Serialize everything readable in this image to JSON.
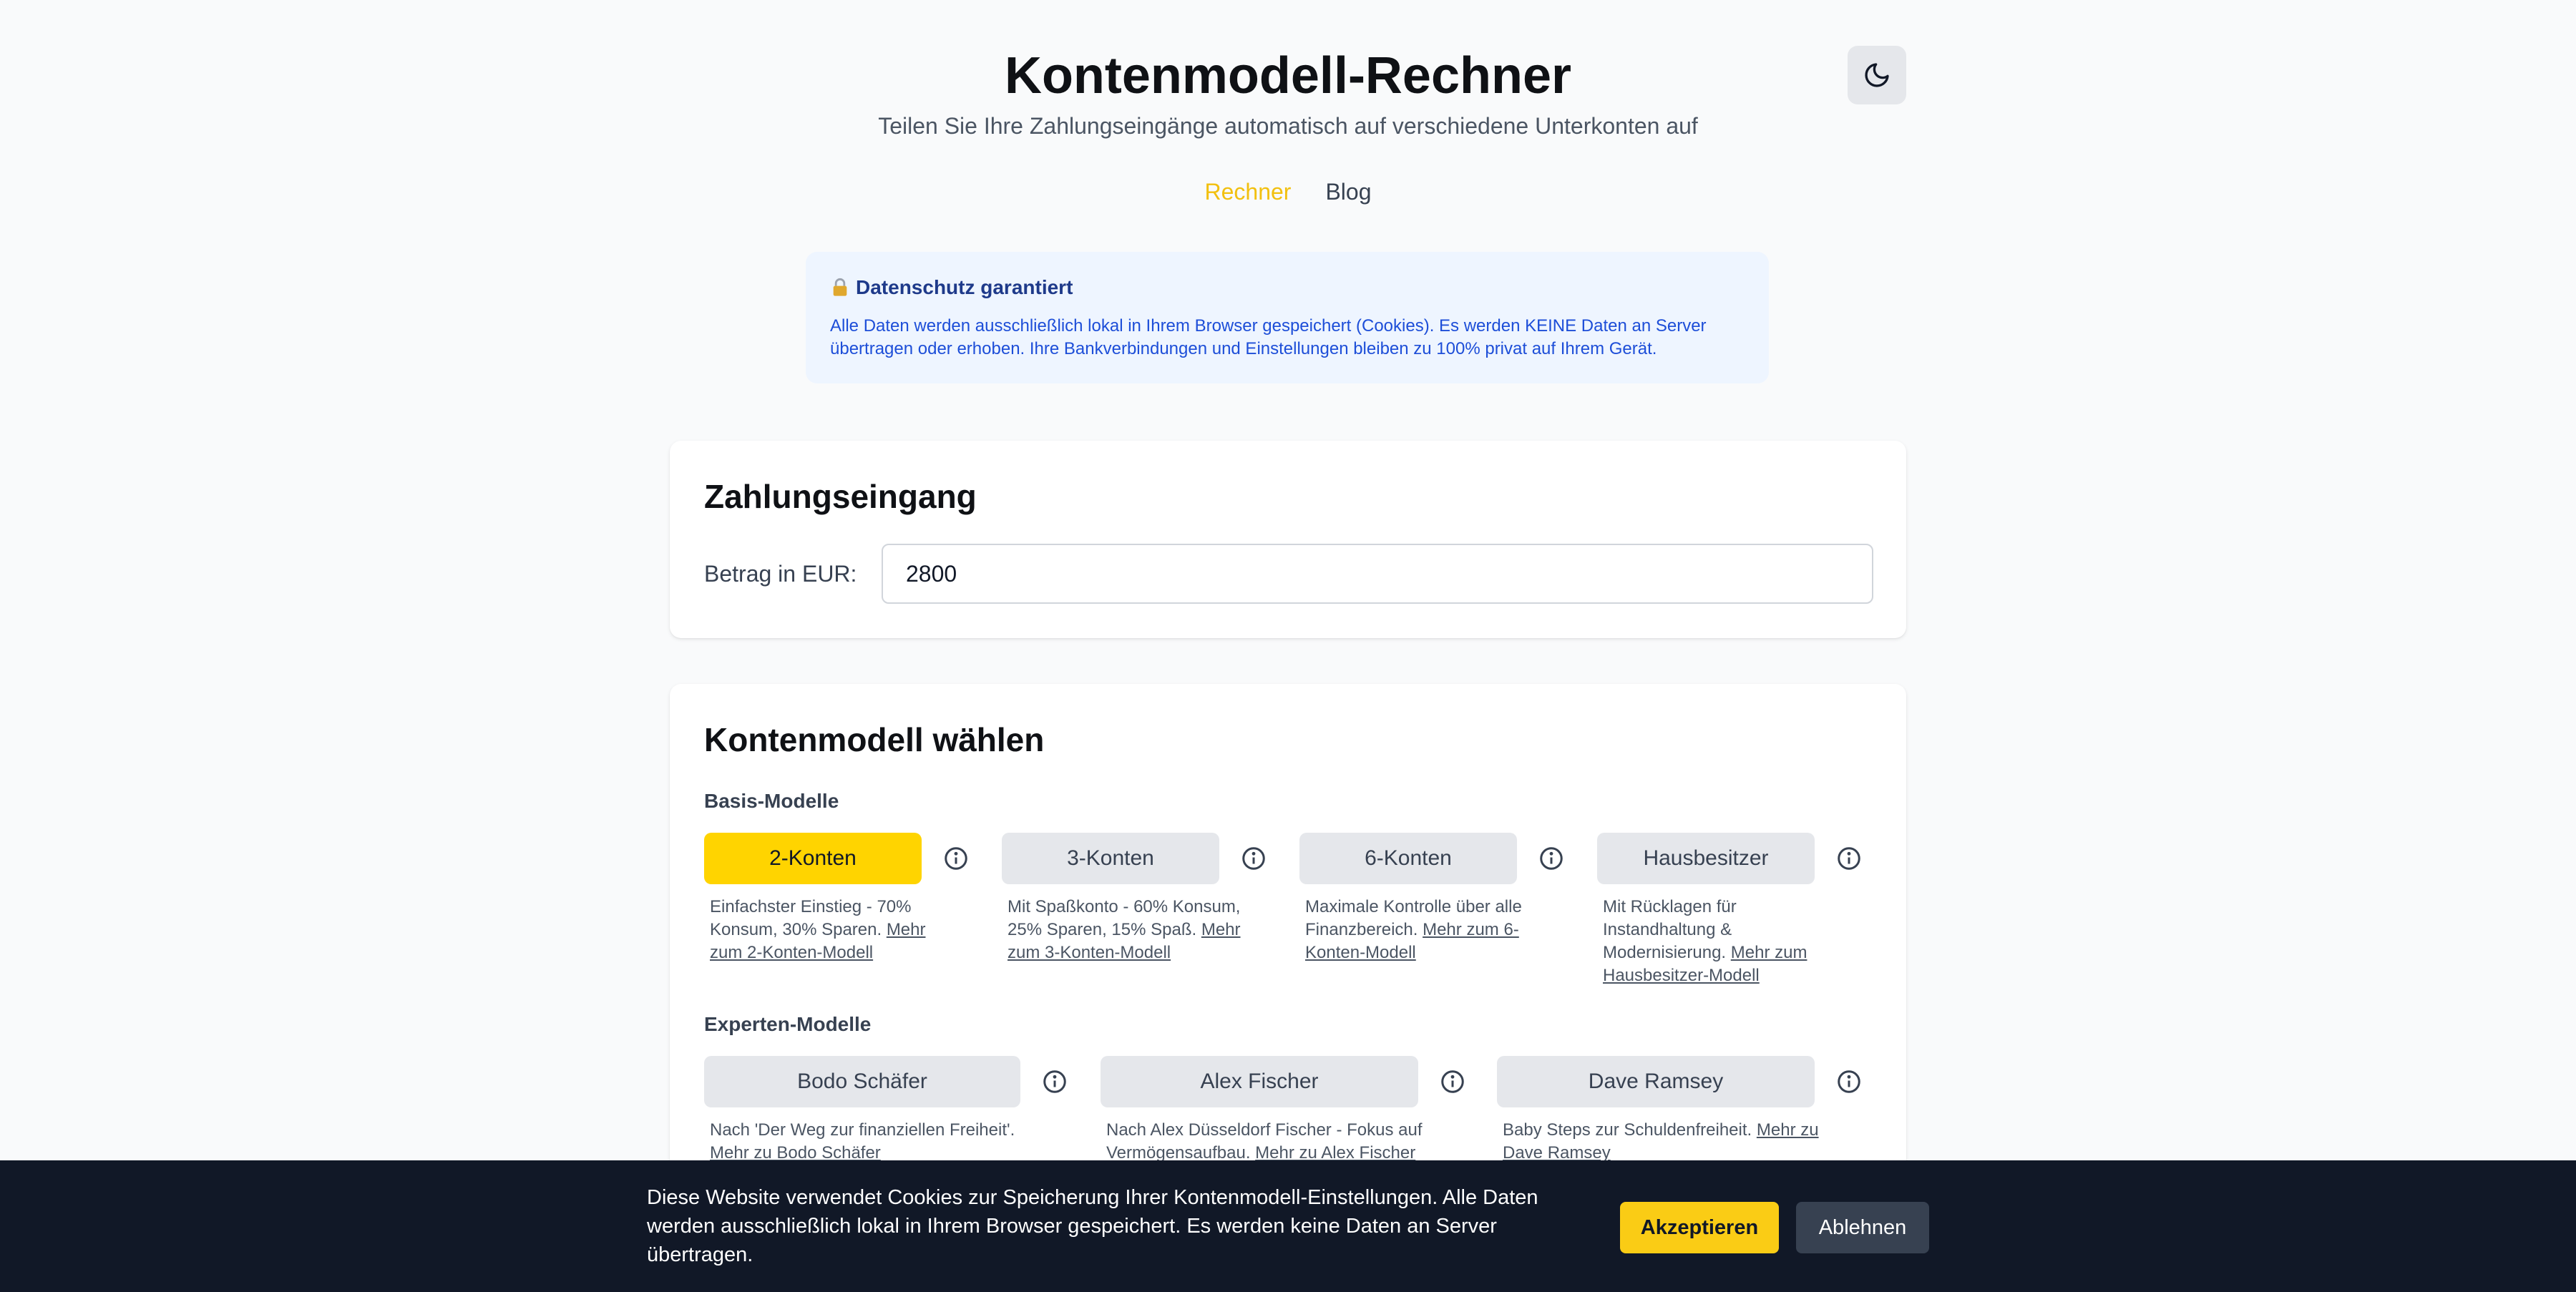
{
  "header": {
    "title": "Kontenmodell-Rechner",
    "subtitle": "Teilen Sie Ihre Zahlungseingänge automatisch auf verschiedene Unterkonten auf"
  },
  "nav": {
    "items": [
      {
        "label": "Rechner",
        "active": true
      },
      {
        "label": "Blog",
        "active": false
      }
    ]
  },
  "privacy": {
    "icon": "lock-icon",
    "title": "Datenschutz garantiert",
    "text_line1": "Alle Daten werden ausschließlich lokal in Ihrem Browser gespeichert (Cookies). Es werden KEINE Daten an Server",
    "text_line2": "übertragen oder erhoben. Ihre Bankverbindungen und Einstellungen bleiben zu 100% privat auf Ihrem Gerät."
  },
  "payment": {
    "title": "Zahlungseingang",
    "amount_label": "Betrag in EUR:",
    "amount_value": "2800"
  },
  "models": {
    "title": "Kontenmodell wählen",
    "basic_label": "Basis-Modelle",
    "basic": [
      {
        "label": "2-Konten",
        "selected": true,
        "desc": "Einfachster Einstieg - 70% Konsum, 30% Sparen.",
        "link": "Mehr zum 2-Konten-Modell"
      },
      {
        "label": "3-Konten",
        "selected": false,
        "desc": "Mit Spaßkonto - 60% Konsum, 25% Sparen, 15% Spaß.",
        "link": "Mehr zum 3-Konten-Modell"
      },
      {
        "label": "6-Konten",
        "selected": false,
        "desc": "Maximale Kontrolle über alle Finanzbereich.",
        "link": "Mehr zum 6-Konten-Modell"
      },
      {
        "label": "Hausbesitzer",
        "selected": false,
        "desc": "Mit Rücklagen für Instandhaltung & Modernisierung.",
        "link": "Mehr zum Hausbesitzer-Modell"
      }
    ],
    "expert_label": "Experten-Modelle",
    "expert": [
      {
        "label": "Bodo Schäfer",
        "selected": false,
        "desc": "Nach 'Der Weg zur finanziellen Freiheit'.",
        "link": "Mehr zu Bodo Schäfer"
      },
      {
        "label": "Alex Fischer",
        "selected": false,
        "desc": "Nach Alex Düsseldorf Fischer - Fokus auf Vermögensaufbau.",
        "link": "Mehr zu Alex Fischer"
      },
      {
        "label": "Dave Ramsey",
        "selected": false,
        "desc": "Baby Steps zur Schuldenfreiheit.",
        "link": "Mehr zu Dave Ramsey"
      }
    ]
  },
  "cookie": {
    "text": "Diese Website verwendet Cookies zur Speicherung Ihrer Kontenmodell-Einstellungen. Alle Daten werden ausschließlich lokal in Ihrem Browser gespeichert. Es werden keine Daten an Server übertragen.",
    "accept": "Akzeptieren",
    "decline": "Ablehnen"
  },
  "colors": {
    "accent": "#ffd400",
    "nav_active": "#f2c00f",
    "privacy_bg": "#eef5ff",
    "cookie_bg": "#111827"
  }
}
